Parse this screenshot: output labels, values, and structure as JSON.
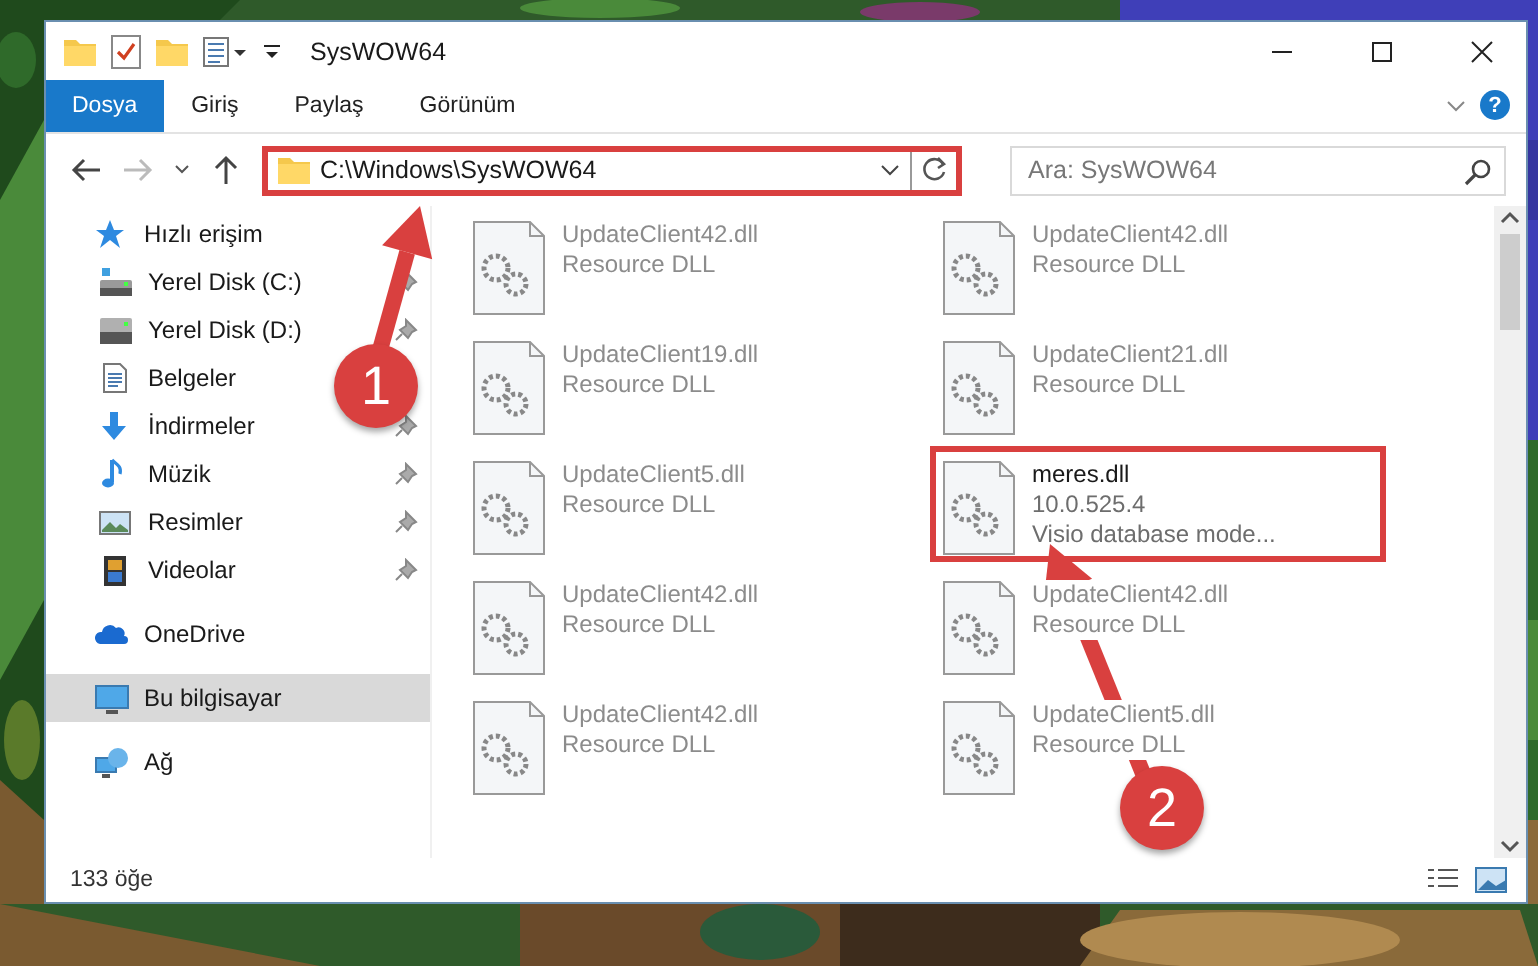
{
  "window": {
    "title": "SysWOW64"
  },
  "ribbon": {
    "tabs": [
      {
        "label": "Dosya",
        "selected": true
      },
      {
        "label": "Giriş",
        "selected": false
      },
      {
        "label": "Paylaş",
        "selected": false
      },
      {
        "label": "Görünüm",
        "selected": false
      }
    ],
    "help": "?"
  },
  "address": {
    "path": "C:\\Windows\\SysWOW64",
    "highlighted": true
  },
  "search": {
    "placeholder": "Ara: SysWOW64"
  },
  "sidebar": {
    "items": [
      {
        "label": "Hızlı erişim",
        "kind": "star",
        "selected": false,
        "pinned": false,
        "children": [
          {
            "label": "Yerel Disk (C:)",
            "kind": "drive-c",
            "selected": false,
            "pinned": true
          },
          {
            "label": "Yerel Disk (D:)",
            "kind": "drive",
            "selected": false,
            "pinned": true
          },
          {
            "label": "Belgeler",
            "kind": "docs",
            "selected": false,
            "pinned": false
          },
          {
            "label": "İndirmeler",
            "kind": "download",
            "selected": false,
            "pinned": true
          },
          {
            "label": "Müzik",
            "kind": "music",
            "selected": false,
            "pinned": true
          },
          {
            "label": "Resimler",
            "kind": "pictures",
            "selected": false,
            "pinned": true
          },
          {
            "label": "Videolar",
            "kind": "video",
            "selected": false,
            "pinned": true
          }
        ]
      },
      {
        "label": "OneDrive",
        "kind": "cloud",
        "selected": false,
        "pinned": false
      },
      {
        "label": "Bu bilgisayar",
        "kind": "pc",
        "selected": true,
        "pinned": false
      },
      {
        "label": "Ağ",
        "kind": "network",
        "selected": false,
        "pinned": false
      }
    ]
  },
  "files": [
    {
      "name": "UpdateClient42.dll",
      "lines": [
        "Resource DLL"
      ],
      "faded": true,
      "highlighted": false
    },
    {
      "name": "UpdateClient42.dll",
      "lines": [
        "Resource DLL"
      ],
      "faded": true,
      "highlighted": false
    },
    {
      "name": "UpdateClient19.dll",
      "lines": [
        "Resource DLL"
      ],
      "faded": true,
      "highlighted": false
    },
    {
      "name": "UpdateClient21.dll",
      "lines": [
        "Resource DLL"
      ],
      "faded": true,
      "highlighted": false
    },
    {
      "name": "UpdateClient5.dll",
      "lines": [
        "Resource DLL"
      ],
      "faded": true,
      "highlighted": false
    },
    {
      "name": "meres.dll",
      "lines": [
        "10.0.525.4",
        "Visio database mode..."
      ],
      "faded": false,
      "highlighted": true
    },
    {
      "name": "UpdateClient42.dll",
      "lines": [
        "Resource DLL"
      ],
      "faded": true,
      "highlighted": false
    },
    {
      "name": "UpdateClient42.dll",
      "lines": [
        "Resource DLL"
      ],
      "faded": true,
      "highlighted": false
    },
    {
      "name": "UpdateClient42.dll",
      "lines": [
        "Resource DLL"
      ],
      "faded": true,
      "highlighted": false
    },
    {
      "name": "UpdateClient5.dll",
      "lines": [
        "Resource DLL"
      ],
      "faded": true,
      "highlighted": false
    }
  ],
  "status_bar": {
    "count": "133 öğe"
  },
  "annotations": [
    {
      "label": "1"
    },
    {
      "label": "2"
    }
  ]
}
